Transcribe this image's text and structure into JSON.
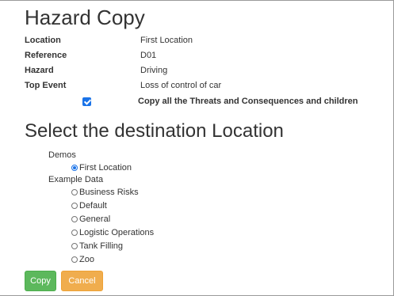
{
  "page": {
    "title": "Hazard Copy"
  },
  "details": [
    {
      "label": "Location",
      "value": "First Location"
    },
    {
      "label": "Reference",
      "value": "D01"
    },
    {
      "label": "Hazard",
      "value": "Driving"
    },
    {
      "label": "Top Event",
      "value": "Loss of control of car"
    }
  ],
  "copy_all": {
    "checked": true,
    "label": "Copy all the Threats and Consequences and children"
  },
  "destination": {
    "heading": "Select the destination Location",
    "groups": [
      {
        "name": "Demos",
        "locations": [
          {
            "label": "First Location",
            "selected": true
          }
        ]
      },
      {
        "name": "Example Data",
        "locations": [
          {
            "label": "Business Risks",
            "selected": false
          },
          {
            "label": "Default",
            "selected": false
          },
          {
            "label": "General",
            "selected": false
          },
          {
            "label": "Logistic Operations",
            "selected": false
          },
          {
            "label": "Tank Filling",
            "selected": false
          },
          {
            "label": "Zoo",
            "selected": false
          }
        ]
      }
    ]
  },
  "actions": {
    "copy_label": "Copy",
    "cancel_label": "Cancel",
    "copy_color": "#5cb85c",
    "cancel_color": "#f0ad4e"
  },
  "icons": {
    "checkbox": "checkbox-checked-icon",
    "radio_selected": "radio-selected-icon",
    "radio_unselected": "radio-unselected-icon"
  }
}
